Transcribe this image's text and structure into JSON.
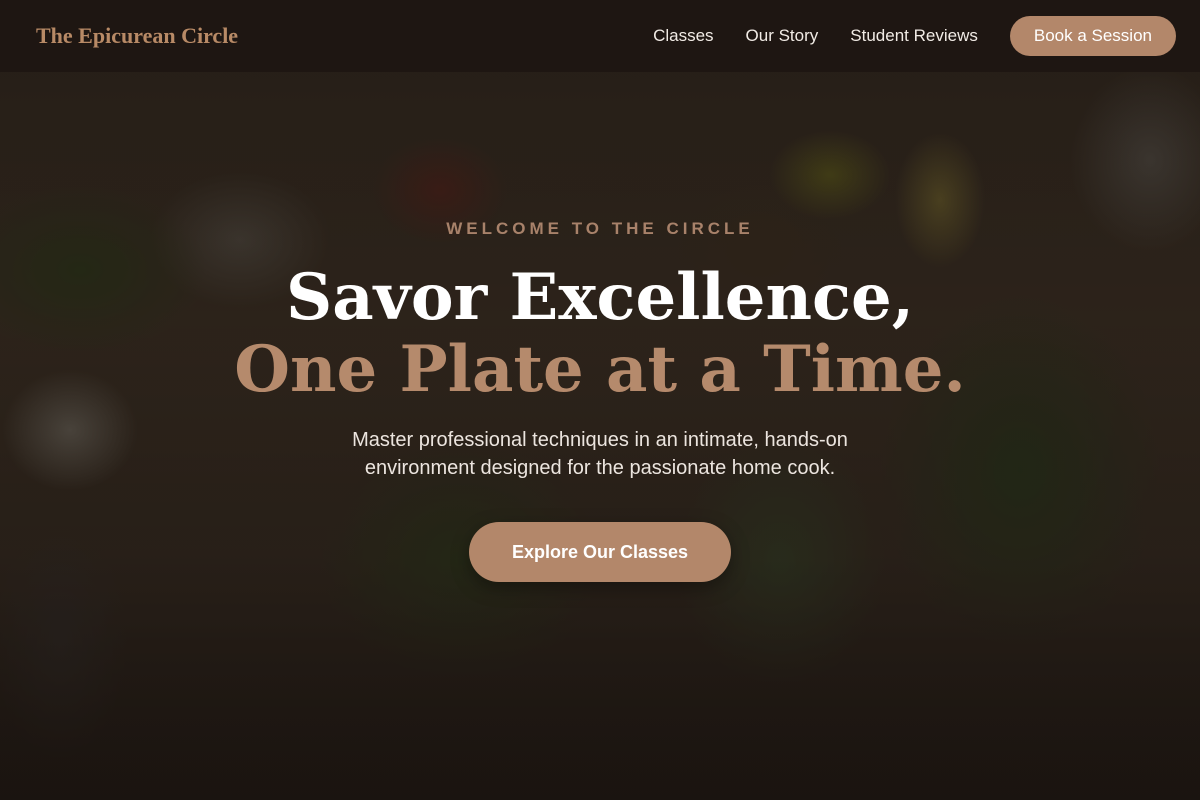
{
  "header": {
    "brand": "The Epicurean Circle",
    "nav": [
      "Classes",
      "Our Story",
      "Student Reviews"
    ],
    "cta": "Book a Session"
  },
  "hero": {
    "eyebrow": "WELCOME TO THE CIRCLE",
    "headline_line1": "Savor Excellence,",
    "headline_line2": "One Plate at a Time.",
    "subtitle": "Master professional techniques in an intimate, hands-on environment designed for the passionate home cook.",
    "cta": "Explore Our Classes"
  },
  "colors": {
    "accent": "#b3876a",
    "header_bg": "#1e1612",
    "headline_accent": "#b58a6c",
    "text_light": "#ffffff"
  }
}
